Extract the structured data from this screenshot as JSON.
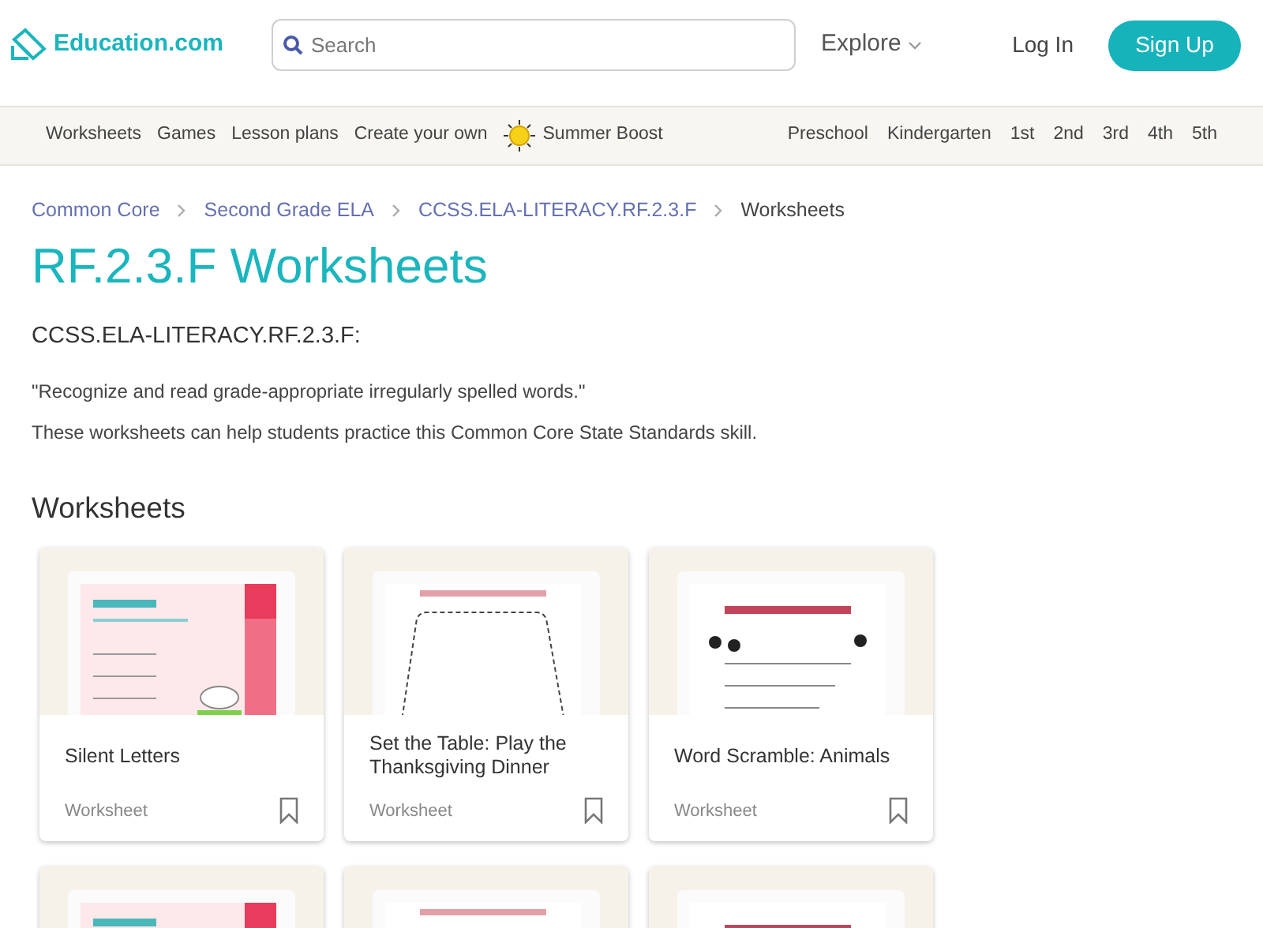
{
  "header": {
    "logo": "Education.com",
    "search": {
      "placeholder": "Search"
    },
    "explore": "Explore",
    "login": "Log In",
    "signup": "Sign Up"
  },
  "nav": {
    "left": [
      {
        "label": "Worksheets",
        "kind": "link"
      },
      {
        "label": "Games",
        "kind": "link"
      },
      {
        "label": "Lesson plans",
        "kind": "link"
      },
      {
        "label": "Create your own",
        "kind": "link"
      },
      {
        "label": "Summer Boost",
        "kind": "promo"
      }
    ],
    "right": [
      "Preschool",
      "Kindergarten",
      "1st",
      "2nd",
      "3rd",
      "4th",
      "5th"
    ]
  },
  "breadcrumb": [
    {
      "label": "Common Core",
      "current": false
    },
    {
      "label": "Second Grade ELA",
      "current": false
    },
    {
      "label": "CCSS.ELA-LITERACY.RF.2.3.F",
      "current": false
    },
    {
      "label": "Worksheets",
      "current": true
    }
  ],
  "title": "RF.2.3.F Worksheets",
  "standard": {
    "code": "CCSS.ELA-LITERACY.RF.2.3.F:",
    "quote": "\"Recognize and read grade-appropriate irregularly spelled words.\"",
    "description": "These worksheets can help students practice this Common Core State Standards skill."
  },
  "section_title": "Worksheets",
  "cards": [
    {
      "title": "Silent Letters",
      "type": "Worksheet"
    },
    {
      "title": "Set the Table: Play the Thanksgiving Dinner",
      "type": "Worksheet"
    },
    {
      "title": "Word Scramble: Animals",
      "type": "Worksheet"
    },
    {
      "kind": "picture"
    },
    {
      "kind": "picture"
    },
    {
      "kind": "picture"
    }
  ]
}
